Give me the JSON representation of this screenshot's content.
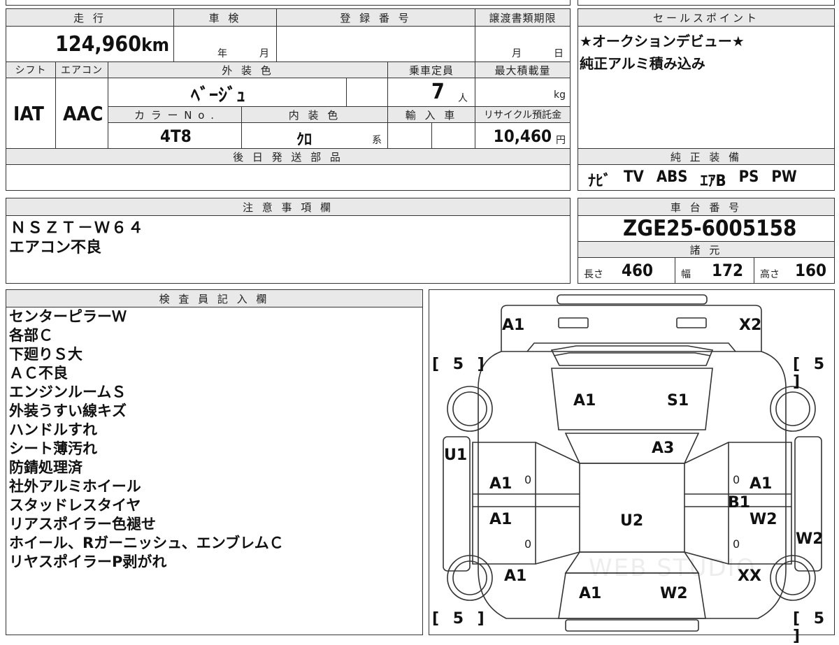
{
  "sheet": {
    "headers": {
      "mileage": "走 行",
      "inspection": "車 検",
      "registration_number": "登 録 番 号",
      "transfer_deadline": "譲渡書類期限",
      "sales_point": "セールスポイント",
      "shift": "シフト",
      "aircon": "エアコン",
      "exterior_color": "外 装 色",
      "capacity": "乗車定員",
      "max_load": "最大積載量",
      "color_no": "カ ラ ー N o .",
      "interior_color": "内 装 色",
      "import": "輸 入 車",
      "recycle_fee": "リサイクル預託金",
      "later_parts": "後 日 発 送 部 品",
      "genuine_equipment": "純 正 装 備",
      "notes": "注 意 事 項 欄",
      "chassis_number": "車 台 番 号",
      "specs": "諸 元",
      "inspector_notes": "検 査 員 記 入 欄"
    },
    "mileage": {
      "value": "124,960",
      "unit": "km"
    },
    "inspection": {
      "year_label": "年",
      "month_label": "月"
    },
    "transfer_deadline": {
      "month_label": "月",
      "day_label": "日"
    },
    "sales_points": [
      "★オークションデビュー★",
      "純正アルミ積み込み"
    ],
    "shift": "IAT",
    "aircon": "AAC",
    "exterior_color": "ﾍﾞｰｼﾞｭ",
    "capacity": {
      "value": "7",
      "unit": "人"
    },
    "max_load": {
      "unit": "kg"
    },
    "color_no": "4T8",
    "interior_color": {
      "value": "ｸﾛ",
      "suffix": "系"
    },
    "recycle_fee": {
      "value": "10,460",
      "unit": "円"
    },
    "equipment": [
      "ﾅﾋﾞ",
      "TV",
      "ABS",
      "ｴｱB",
      "PS",
      "PW"
    ],
    "notes_lines": [
      "ＮＳＺＴ－Ｗ６４",
      "エアコン不良"
    ],
    "chassis_number": "ZGE25-6005158",
    "specs": {
      "length_label": "長さ",
      "length": "460",
      "width_label": "幅",
      "width": "172",
      "height_label": "高さ",
      "height": "160"
    },
    "inspector_lines": [
      "センターピラーＷ",
      "各部Ｃ",
      "下廻りＳ大",
      "ＡＣ不良",
      "エンジンルームＳ",
      "外装うすい線キズ",
      "ハンドルすれ",
      "シート薄汚れ",
      "防錆処理済",
      "社外アルミホイール",
      "スタッドレスタイヤ",
      "リアスポイラー色褪せ",
      "ホイール、Rガーニッシュ、エンブレムＣ",
      "リヤスポイラーP剥がれ"
    ],
    "diagram": {
      "tire_marks": [
        "[ 5 ]",
        "[ 5 ]",
        "[ 5 ]",
        "[ 5 ]"
      ],
      "damage": {
        "front_left_corner": "A1",
        "front_right_corner": "X2",
        "hood_left": "A1",
        "hood_right": "S1",
        "windshield": "A3",
        "left_pillar": "U1",
        "left_front_door": "A1",
        "left_rear_door": "A1",
        "right_front_door": "A1",
        "right_pillar": "B1",
        "right_rear_door": "W2",
        "right_rear_side": "W2",
        "roof": "U2",
        "left_rear_corner": "A1",
        "rear_right_corner": "XX",
        "trunk_left": "A1",
        "trunk_right": "W2"
      },
      "zeros": [
        "0",
        "0",
        "0",
        "0"
      ],
      "watermark": "WEB STUDIO"
    }
  }
}
